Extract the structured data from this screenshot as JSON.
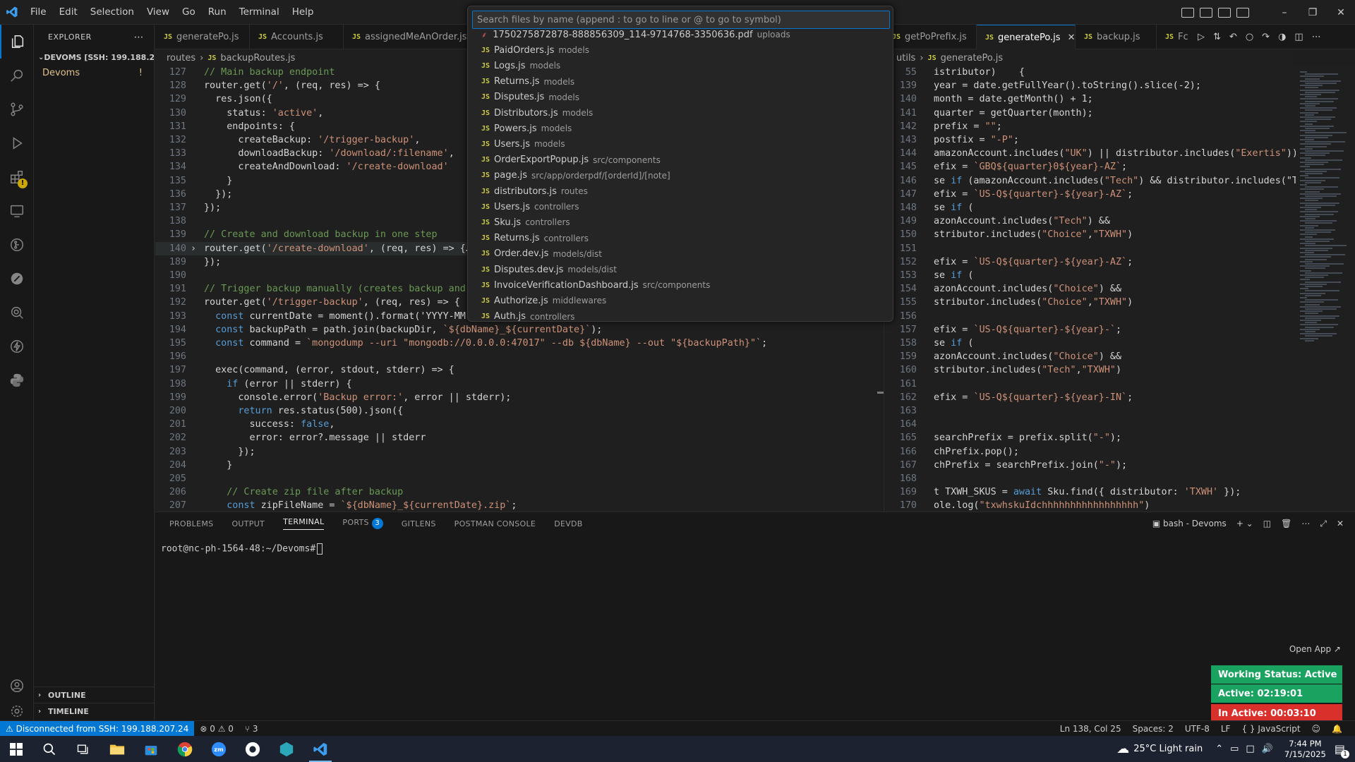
{
  "titlebar": {
    "menu": [
      "File",
      "Edit",
      "Selection",
      "View",
      "Go",
      "Run",
      "Terminal",
      "Help"
    ]
  },
  "sidebar": {
    "title": "EXPLORER",
    "workspace": "DEVOMS [SSH: 199.188.20...",
    "folder": "Devoms",
    "folder_mark": "!",
    "outline": "OUTLINE",
    "timeline": "TIMELINE"
  },
  "left_tabs": [
    "generatePo.js",
    "Accounts.js",
    "assignedMeAnOrder.js"
  ],
  "right_tabs": [
    {
      "label": "getPoPrefix.js",
      "active": false
    },
    {
      "label": "generatePo.js",
      "active": true
    },
    {
      "label": "backup.js",
      "active": false
    },
    {
      "label": "Fc",
      "active": false
    }
  ],
  "left_breadcrumb": [
    "routes",
    "backupRoutes.js"
  ],
  "right_breadcrumb": [
    "utils",
    "generatePo.js"
  ],
  "left_editor": [
    {
      "n": "127",
      "t": "// Main backup endpoint"
    },
    {
      "n": "128",
      "t": "router.get('/', (req, res) => {"
    },
    {
      "n": "129",
      "t": "  res.json({"
    },
    {
      "n": "130",
      "t": "    status: 'active',"
    },
    {
      "n": "131",
      "t": "    endpoints: {"
    },
    {
      "n": "132",
      "t": "      createBackup: '/trigger-backup',"
    },
    {
      "n": "133",
      "t": "      downloadBackup: '/download/:filename',"
    },
    {
      "n": "134",
      "t": "      createAndDownload: '/create-download'"
    },
    {
      "n": "135",
      "t": "    }"
    },
    {
      "n": "136",
      "t": "  });"
    },
    {
      "n": "137",
      "t": "});"
    },
    {
      "n": "138",
      "t": ""
    },
    {
      "n": "139",
      "t": "// Create and download backup in one step"
    },
    {
      "n": "140",
      "t": "router.get('/create-download', (req, res) => {…"
    },
    {
      "n": "189",
      "t": "});"
    },
    {
      "n": "190",
      "t": ""
    },
    {
      "n": "191",
      "t": "// Trigger backup manually (creates backup and r"
    },
    {
      "n": "192",
      "t": "router.get('/trigger-backup', (req, res) => {"
    },
    {
      "n": "193",
      "t": "  const currentDate = moment().format('YYYY-MM-D"
    },
    {
      "n": "194",
      "t": "  const backupPath = path.join(backupDir, `${dbName}_${currentDate}`);"
    },
    {
      "n": "195",
      "t": "  const command = `mongodump --uri \"mongodb://0.0.0.0:47017\" --db ${dbName} --out \"${backupPath}\"`;"
    },
    {
      "n": "196",
      "t": ""
    },
    {
      "n": "197",
      "t": "  exec(command, (error, stdout, stderr) => {"
    },
    {
      "n": "198",
      "t": "    if (error || stderr) {"
    },
    {
      "n": "199",
      "t": "      console.error('Backup error:', error || stderr);"
    },
    {
      "n": "200",
      "t": "      return res.status(500).json({"
    },
    {
      "n": "201",
      "t": "        success: false,"
    },
    {
      "n": "202",
      "t": "        error: error?.message || stderr"
    },
    {
      "n": "203",
      "t": "      });"
    },
    {
      "n": "204",
      "t": "    }"
    },
    {
      "n": "205",
      "t": ""
    },
    {
      "n": "206",
      "t": "    // Create zip file after backup"
    },
    {
      "n": "207",
      "t": "    const zipFileName = `${dbName}_${currentDate}.zip`;"
    }
  ],
  "right_editor": [
    {
      "n": "55",
      "t": "istributor)    {"
    },
    {
      "n": "139",
      "t": "year = date.getFullYear().toString().slice(-2);"
    },
    {
      "n": "140",
      "t": "month = date.getMonth() + 1;"
    },
    {
      "n": "141",
      "t": "quarter = getQuarter(month);"
    },
    {
      "n": "142",
      "t": "prefix = \"\";"
    },
    {
      "n": "143",
      "t": "postfix = \"-P\";"
    },
    {
      "n": "144",
      "t": "amazonAccount.includes(\"UK\") || distributor.includes(\"Exertis\")) {"
    },
    {
      "n": "145",
      "t": "efix = `GBQ${quarter}0${year}-AZ`;"
    },
    {
      "n": "146",
      "t": "se if (amazonAccount.includes(\"Tech\") && distributor.includes(\"Tec"
    },
    {
      "n": "147",
      "t": "efix = `US-Q${quarter}-${year}-AZ`;"
    },
    {
      "n": "148",
      "t": "se if ("
    },
    {
      "n": "149",
      "t": "azonAccount.includes(\"Tech\") &&"
    },
    {
      "n": "150",
      "t": "stributor.includes(\"Choice\",\"TXWH\")"
    },
    {
      "n": "151",
      "t": ""
    },
    {
      "n": "152",
      "t": "efix = `US-Q${quarter}-${year}-AZ`;"
    },
    {
      "n": "153",
      "t": "se if ("
    },
    {
      "n": "154",
      "t": "azonAccount.includes(\"Choice\") &&"
    },
    {
      "n": "155",
      "t": "stributor.includes(\"Choice\",\"TXWH\")"
    },
    {
      "n": "156",
      "t": ""
    },
    {
      "n": "157",
      "t": "efix = `US-Q${quarter}-${year}-`;"
    },
    {
      "n": "158",
      "t": "se if ("
    },
    {
      "n": "159",
      "t": "azonAccount.includes(\"Choice\") &&"
    },
    {
      "n": "160",
      "t": "stributor.includes(\"Tech\",\"TXWH\")"
    },
    {
      "n": "161",
      "t": ""
    },
    {
      "n": "162",
      "t": "efix = `US-Q${quarter}-${year}-IN`;"
    },
    {
      "n": "163",
      "t": ""
    },
    {
      "n": "164",
      "t": ""
    },
    {
      "n": "165",
      "t": "searchPrefix = prefix.split(\"-\");"
    },
    {
      "n": "166",
      "t": "chPrefix.pop();"
    },
    {
      "n": "167",
      "t": "chPrefix = searchPrefix.join(\"-\");"
    },
    {
      "n": "168",
      "t": ""
    },
    {
      "n": "169",
      "t": "t TXWH_SKUS = await Sku.find({ distributor: 'TXWH' });"
    },
    {
      "n": "170",
      "t": "ole.log(\"txwhskuIdchhhhhhhhhhhhhhhhh\")"
    }
  ],
  "quick_open": {
    "placeholder": "Search files by name (append : to go to line or @ to go to symbol)",
    "items": [
      {
        "name": "1750275872878-888856309_114-9714768-3350636.pdf",
        "path": "uploads",
        "pdf": true
      },
      {
        "name": "PaidOrders.js",
        "path": "models"
      },
      {
        "name": "Logs.js",
        "path": "models"
      },
      {
        "name": "Returns.js",
        "path": "models"
      },
      {
        "name": "Disputes.js",
        "path": "models"
      },
      {
        "name": "Distributors.js",
        "path": "models"
      },
      {
        "name": "Powers.js",
        "path": "models"
      },
      {
        "name": "Users.js",
        "path": "models"
      },
      {
        "name": "OrderExportPopup.js",
        "path": "src/components"
      },
      {
        "name": "page.js",
        "path": "src/app/orderpdf/[orderId]/[note]"
      },
      {
        "name": "distributors.js",
        "path": "routes"
      },
      {
        "name": "Users.js",
        "path": "controllers"
      },
      {
        "name": "Sku.js",
        "path": "controllers"
      },
      {
        "name": "Returns.js",
        "path": "controllers"
      },
      {
        "name": "Order.dev.js",
        "path": "models/dist"
      },
      {
        "name": "Disputes.dev.js",
        "path": "models/dist"
      },
      {
        "name": "InvoiceVerificationDashboard.js",
        "path": "src/components"
      },
      {
        "name": "Authorize.js",
        "path": "middlewares"
      },
      {
        "name": "Auth.js",
        "path": "controllers"
      }
    ]
  },
  "panel": {
    "tabs": [
      "PROBLEMS",
      "OUTPUT",
      "TERMINAL",
      "PORTS",
      "GITLENS",
      "POSTMAN CONSOLE",
      "DEVDB"
    ],
    "ports_count": "3",
    "terminal_name": "bash - Devoms",
    "prompt": "root@nc-ph-1564-48:~/Devoms#"
  },
  "work_status": {
    "open_app": "Open App ↗",
    "working": "Working Status: Active",
    "active": "Active: 02:19:01",
    "inactive": "In Active: 00:03:10",
    "colors": {
      "working": "#1aa260",
      "active": "#1aa260",
      "inactive": "#d9302c"
    }
  },
  "statusbar": {
    "remote": "⚠ Disconnected from SSH: 199.188.207.24",
    "errors": "⊗ 0",
    "warnings": "⚠ 0",
    "ports": "⑂ 3",
    "position": "Ln 138, Col 25",
    "spaces": "Spaces: 2",
    "encoding": "UTF-8",
    "eol": "LF",
    "language": "{ } JavaScript"
  },
  "taskbar": {
    "weather": "25°C  Light rain",
    "time": "7:44 PM",
    "date": "7/15/2025",
    "notifications": "1"
  }
}
